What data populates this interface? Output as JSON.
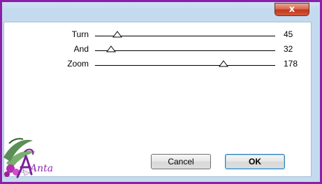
{
  "window": {
    "close_glyph": "x"
  },
  "sliders": [
    {
      "label": "Turn",
      "value": "45",
      "level": 45,
      "min": 0,
      "max": 360
    },
    {
      "label": "And",
      "value": "32",
      "level": 32,
      "min": 0,
      "max": 360
    },
    {
      "label": "Zoom",
      "value": "178",
      "level": 178,
      "min": 0,
      "max": 250
    }
  ],
  "buttons": {
    "cancel_label": "Cancel",
    "ok_label": "OK"
  },
  "watermark": {
    "text": "Anta"
  },
  "colors": {
    "frame": "#8c1fa8",
    "ok_border": "#3c7fb1",
    "close": "#c2361a"
  }
}
